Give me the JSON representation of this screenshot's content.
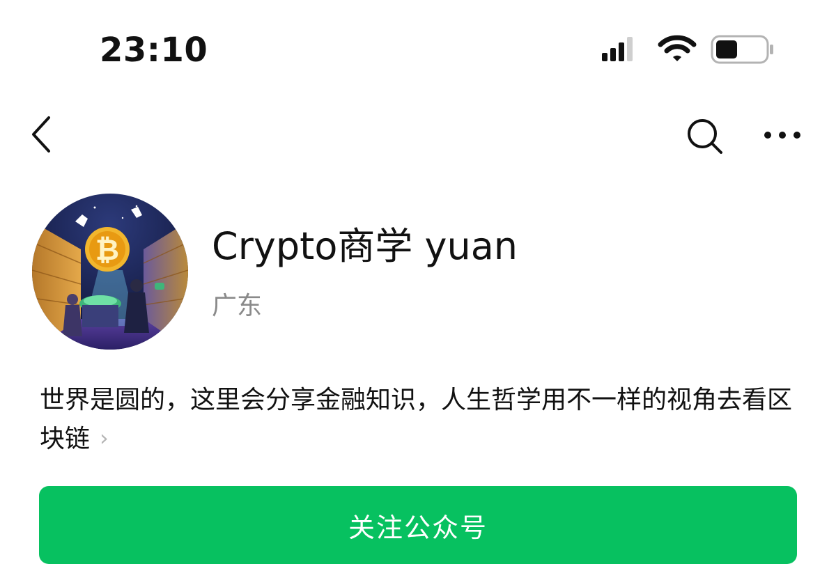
{
  "status_bar": {
    "time": "23:10",
    "icons": [
      "cellular-signal-icon",
      "wifi-icon",
      "battery-icon"
    ]
  },
  "nav": {
    "icons": [
      "back-arrow-icon",
      "search-icon",
      "more-icon"
    ]
  },
  "account": {
    "name": "Crypto商学 yuan",
    "region": "广东",
    "description": "世界是圆的，这里会分享金融知识，人生哲学用不一样的视角去看区块链",
    "description_chevron": "›",
    "avatar_description": "bitcoin-vault-illustration"
  },
  "actions": {
    "follow_label": "关注公众号"
  },
  "colors": {
    "accent_green": "#07c160",
    "secondary_text": "#8a8a8a",
    "primary_text": "#111111"
  }
}
